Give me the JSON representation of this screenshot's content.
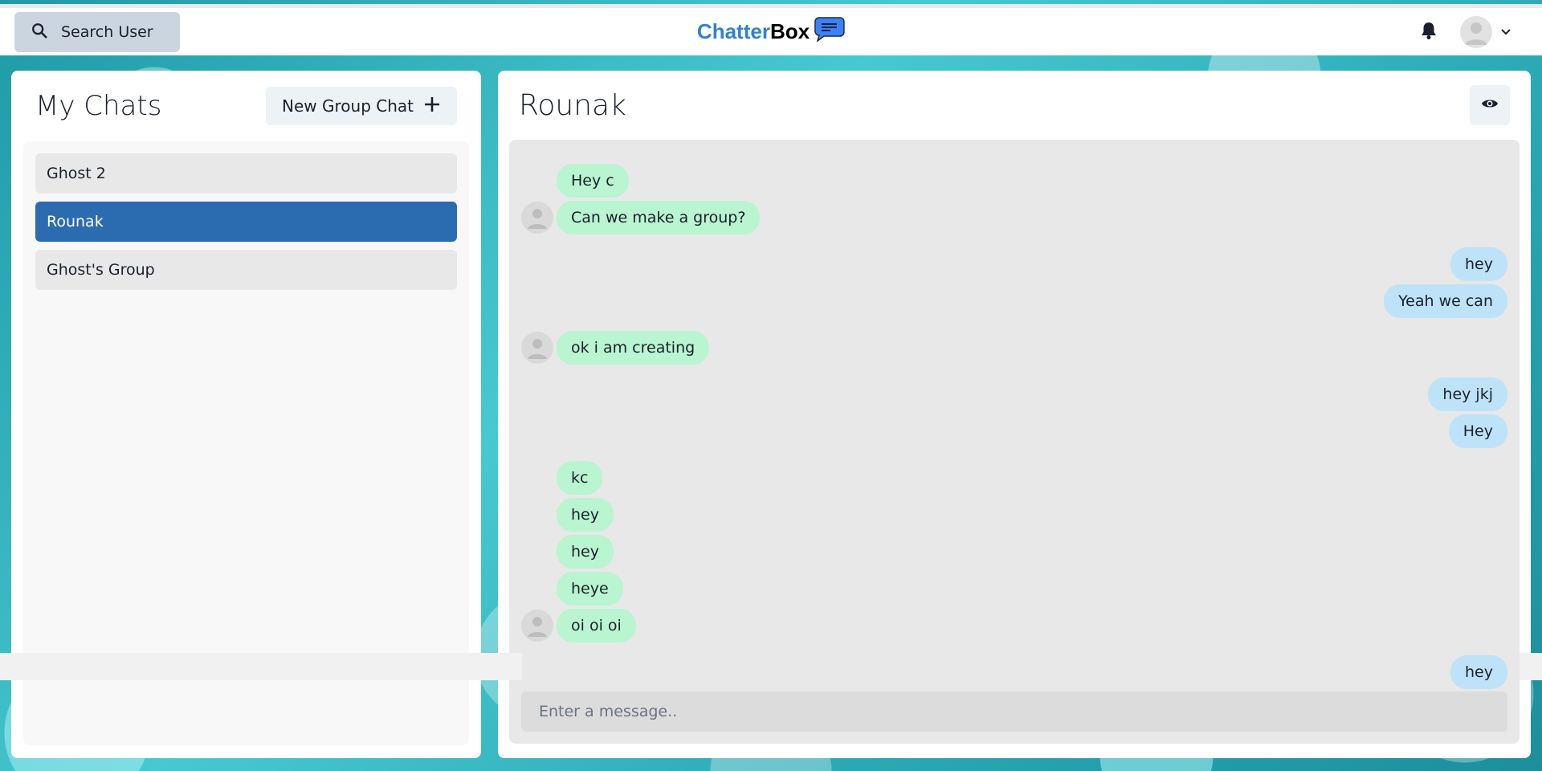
{
  "topbar": {
    "search_label": "Search User",
    "brand_part1": "Chatter",
    "brand_part2": "Box"
  },
  "sidebar": {
    "title": "My Chats",
    "new_group_label": "New Group Chat",
    "chats": [
      {
        "name": "Ghost 2",
        "active": false
      },
      {
        "name": "Rounak",
        "active": true
      },
      {
        "name": "Ghost's Group",
        "active": false
      }
    ]
  },
  "chat": {
    "name": "Rounak",
    "input_placeholder": "Enter a message..",
    "messages": [
      {
        "text": "Hey c",
        "from": "other",
        "avatar": false
      },
      {
        "text": "Can we make a group?",
        "from": "other",
        "avatar": true
      },
      {
        "text": "hey",
        "from": "me"
      },
      {
        "text": "Yeah we can",
        "from": "me"
      },
      {
        "text": "ok i am creating",
        "from": "other",
        "avatar": true
      },
      {
        "text": "hey jkj",
        "from": "me"
      },
      {
        "text": "Hey",
        "from": "me"
      },
      {
        "text": "kc",
        "from": "other",
        "avatar": false
      },
      {
        "text": "hey",
        "from": "other",
        "avatar": false
      },
      {
        "text": "hey",
        "from": "other",
        "avatar": false
      },
      {
        "text": "heye",
        "from": "other",
        "avatar": false
      },
      {
        "text": "oi oi oi",
        "from": "other",
        "avatar": true
      },
      {
        "text": "hey",
        "from": "me"
      }
    ]
  },
  "colors": {
    "brand_blue": "#3182ce",
    "active_chat": "#2b6cb0",
    "incoming_bubble": "#b9f5d0",
    "outgoing_bubble": "#bee3f8"
  }
}
